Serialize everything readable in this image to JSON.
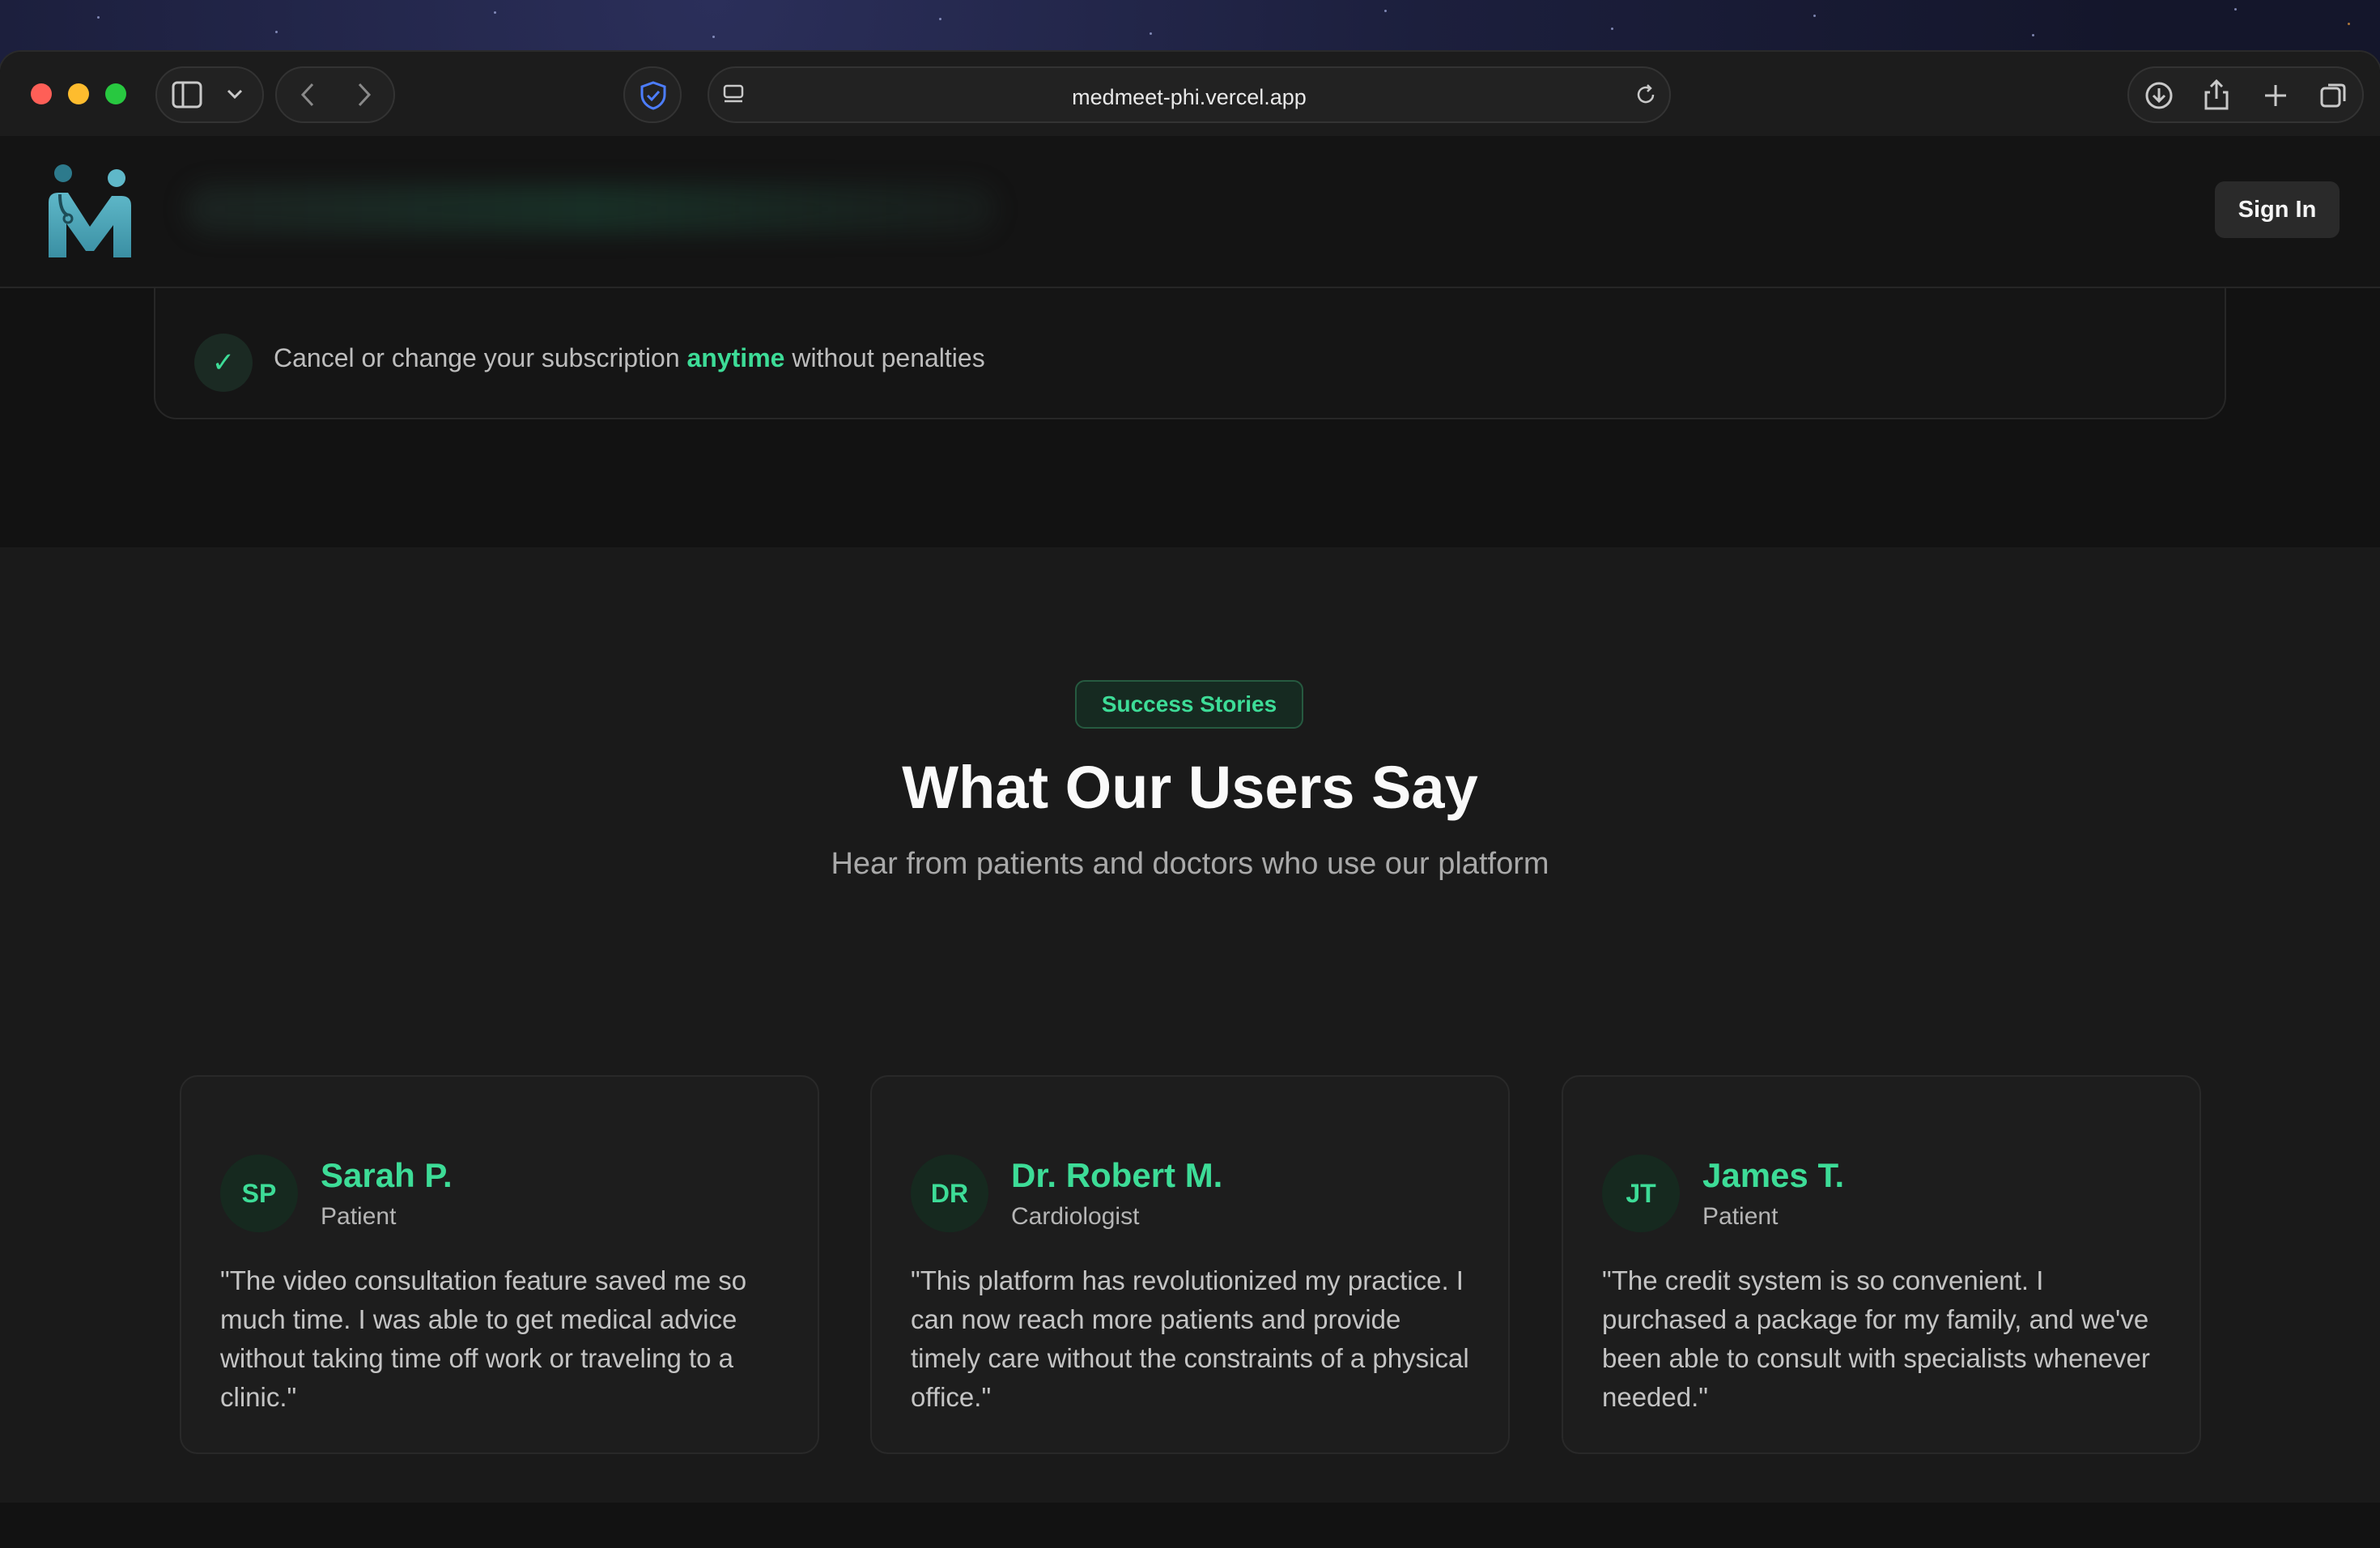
{
  "browser": {
    "url": "medmeet-phi.vercel.app"
  },
  "header": {
    "sign_in_label": "Sign In"
  },
  "subscription_feature": {
    "text_before": "Cancel or change your subscription ",
    "highlight": "anytime",
    "text_after": " without penalties"
  },
  "testimonials": {
    "badge": "Success Stories",
    "title": "What Our Users Say",
    "subtitle": "Hear from patients and doctors who use our platform",
    "cards": [
      {
        "initials": "SP",
        "name": "Sarah P.",
        "role": "Patient",
        "quote": "\"The video consultation feature saved me so much time. I was able to get medical advice without taking time off work or traveling to a clinic.\""
      },
      {
        "initials": "DR",
        "name": "Dr. Robert M.",
        "role": "Cardiologist",
        "quote": "\"This platform has revolutionized my practice. I can now reach more patients and provide timely care without the constraints of a physical office.\""
      },
      {
        "initials": "JT",
        "name": "James T.",
        "role": "Patient",
        "quote": "\"The credit system is so convenient. I purchased a package for my family, and we've been able to consult with specialists whenever needed.\""
      }
    ]
  },
  "colors": {
    "accent": "#3ddc97",
    "background": "#121212",
    "card": "#1d1d1d"
  }
}
